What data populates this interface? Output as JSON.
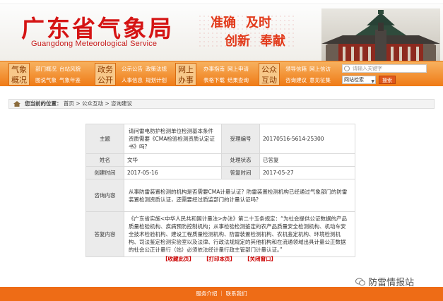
{
  "header": {
    "logo_cn": "广东省气象局",
    "logo_en": "Guangdong Meteorological Service",
    "slogans": [
      "准确",
      "及时",
      "创新",
      "奉献"
    ]
  },
  "nav": {
    "groups": [
      {
        "tag": "气象概况",
        "links": [
          "部门概况",
          "台站风貌",
          "图说气象",
          "气象年鉴"
        ]
      },
      {
        "tag": "政务公开",
        "links": [
          "公示公告",
          "政策法规",
          "人事信息",
          "规划计划"
        ]
      },
      {
        "tag": "网上办事",
        "links": [
          "办事指南",
          "网上申请",
          "表格下载",
          "结果查询"
        ]
      },
      {
        "tag": "公众互动",
        "links": [
          "领导信箱",
          "网上信访",
          "咨询建议",
          "意见征集"
        ]
      }
    ],
    "search_placeholder": "请输入关键字",
    "search_scope": "网站检索",
    "search_button": "搜索"
  },
  "breadcrumb": {
    "label": "您当前的位置：",
    "path": "首页 > 公众互动 > 咨询建议"
  },
  "detail": {
    "labels": {
      "subject": "主题",
      "accept_no": "受理编号",
      "name": "姓名",
      "status": "处理状态",
      "created": "创建时间",
      "replied": "答复时间",
      "question": "咨询内容",
      "answer": "答复内容"
    },
    "subject": "请问雷电防护检测单位检测基本条件资质需要《CMA检验检测资质认定证书》吗？",
    "accept_no": "20170516-5614-25300",
    "name": "文华",
    "status": "已答复",
    "created": "2017-05-16",
    "replied": "2017-05-27",
    "question": "从事防雷装置检测的机构是否需要CMA计量认证？防雷装置检测机构已经通过气象部门的防雷装置检测资质认证，还需要经过质监部门的计量认证吗？",
    "answer": "《广东省实施<中华人民共和国计量法>办法》第二十五条规定：“为社会提供公证数据的产品质量检验机构、疾病预防控制机构；从事检验检测鉴定的农产品质量安全检测机构、机动车安全技术检验机构、建设工程质量检测机构、防雷装置检测机构、农机鉴定机构、环境检测机构、司法鉴定检测实验室以及法律、行政法规规定的其他机构和在流通领域出具计量公正数据的社会公正计量行（站）必须依法经计量行政主管部门计量认证。”"
  },
  "actions": [
    "【收藏此页】",
    "【打印本页】",
    "【关闭窗口】"
  ],
  "watermark": "防雷情报站",
  "footer": "服务介绍 ｜ 联系我们",
  "colors": {
    "brand_red": "#d51414",
    "nav_orange": "#ef7a15",
    "footer_orange": "#ee6c16"
  }
}
